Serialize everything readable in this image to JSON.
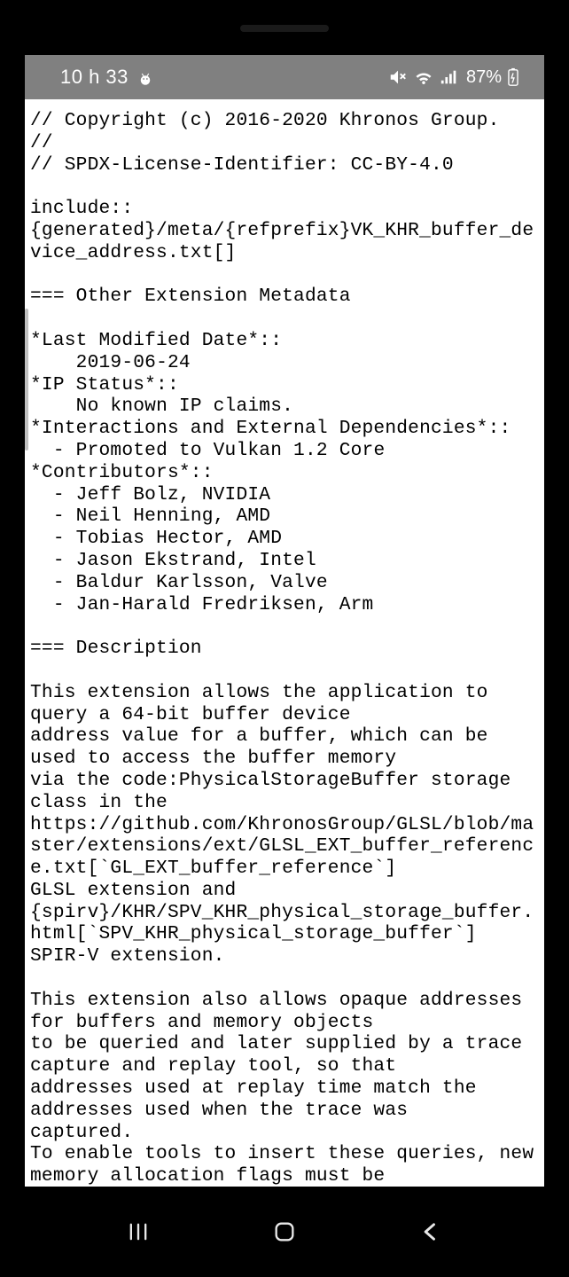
{
  "status_bar": {
    "time": "10 h 33",
    "battery": "87%"
  },
  "document": {
    "text": "// Copyright (c) 2016-2020 Khronos Group.\n//\n// SPDX-License-Identifier: CC-BY-4.0\n\ninclude::{generated}/meta/{refprefix}VK_KHR_buffer_device_address.txt[]\n\n=== Other Extension Metadata\n\n*Last Modified Date*::\n    2019-06-24\n*IP Status*::\n    No known IP claims.\n*Interactions and External Dependencies*::\n  - Promoted to Vulkan 1.2 Core\n*Contributors*::\n  - Jeff Bolz, NVIDIA\n  - Neil Henning, AMD\n  - Tobias Hector, AMD\n  - Jason Ekstrand, Intel\n  - Baldur Karlsson, Valve\n  - Jan-Harald Fredriksen, Arm\n\n=== Description\n\nThis extension allows the application to query a 64-bit buffer device\naddress value for a buffer, which can be used to access the buffer memory\nvia the code:PhysicalStorageBuffer storage class in the\nhttps://github.com/KhronosGroup/GLSL/blob/master/extensions/ext/GLSL_EXT_buffer_reference.txt[`GL_EXT_buffer_reference`]\nGLSL extension and\n{spirv}/KHR/SPV_KHR_physical_storage_buffer.html[`SPV_KHR_physical_storage_buffer`]\nSPIR-V extension.\n\nThis extension also allows opaque addresses for buffers and memory objects\nto be queried and later supplied by a trace capture and replay tool, so that\naddresses used at replay time match the addresses used when the trace was\ncaptured.\nTo enable tools to insert these queries, new memory allocation flags must be"
  }
}
